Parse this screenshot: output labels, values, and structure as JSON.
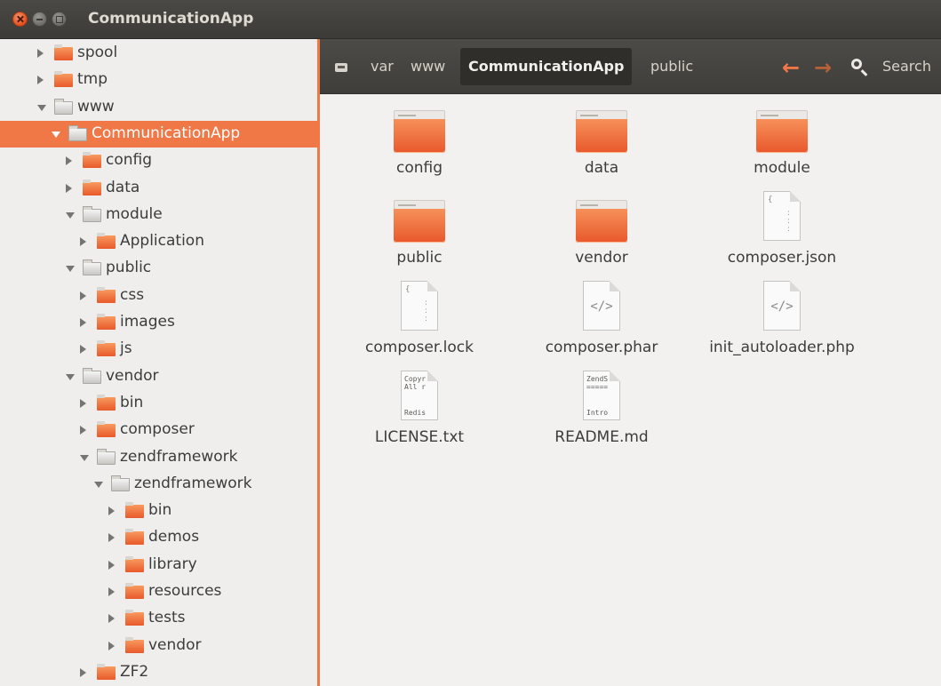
{
  "window": {
    "title": "CommunicationApp"
  },
  "sidebar": {
    "items": [
      {
        "label": "spool",
        "depth": 0,
        "state": "collapsed",
        "folder": "orange"
      },
      {
        "label": "tmp",
        "depth": 0,
        "state": "collapsed",
        "folder": "orange"
      },
      {
        "label": "www",
        "depth": 0,
        "state": "expanded",
        "folder": "gray"
      },
      {
        "label": "CommunicationApp",
        "depth": 1,
        "state": "expanded",
        "folder": "gray",
        "selected": true
      },
      {
        "label": "config",
        "depth": 2,
        "state": "collapsed",
        "folder": "orange"
      },
      {
        "label": "data",
        "depth": 2,
        "state": "collapsed",
        "folder": "orange"
      },
      {
        "label": "module",
        "depth": 2,
        "state": "expanded",
        "folder": "gray"
      },
      {
        "label": "Application",
        "depth": 3,
        "state": "collapsed",
        "folder": "orange"
      },
      {
        "label": "public",
        "depth": 2,
        "state": "expanded",
        "folder": "gray"
      },
      {
        "label": "css",
        "depth": 3,
        "state": "collapsed",
        "folder": "orange"
      },
      {
        "label": "images",
        "depth": 3,
        "state": "collapsed",
        "folder": "orange"
      },
      {
        "label": "js",
        "depth": 3,
        "state": "collapsed",
        "folder": "orange"
      },
      {
        "label": "vendor",
        "depth": 2,
        "state": "expanded",
        "folder": "gray"
      },
      {
        "label": "bin",
        "depth": 3,
        "state": "collapsed",
        "folder": "orange"
      },
      {
        "label": "composer",
        "depth": 3,
        "state": "collapsed",
        "folder": "orange"
      },
      {
        "label": "zendframework",
        "depth": 3,
        "state": "expanded",
        "folder": "gray"
      },
      {
        "label": "zendframework",
        "depth": 4,
        "state": "expanded",
        "folder": "gray"
      },
      {
        "label": "bin",
        "depth": 5,
        "state": "collapsed",
        "folder": "orange"
      },
      {
        "label": "demos",
        "depth": 5,
        "state": "collapsed",
        "folder": "orange"
      },
      {
        "label": "library",
        "depth": 5,
        "state": "collapsed",
        "folder": "orange"
      },
      {
        "label": "resources",
        "depth": 5,
        "state": "collapsed",
        "folder": "orange"
      },
      {
        "label": "tests",
        "depth": 5,
        "state": "collapsed",
        "folder": "orange"
      },
      {
        "label": "vendor",
        "depth": 5,
        "state": "collapsed",
        "folder": "orange"
      },
      {
        "label": "ZF2",
        "depth": 3,
        "state": "collapsed",
        "folder": "orange"
      }
    ]
  },
  "toolbar": {
    "breadcrumbs": [
      "var",
      "www",
      "CommunicationApp",
      "public"
    ],
    "active_crumb": "CommunicationApp",
    "back_icon": "arrow-left-icon",
    "forward_icon": "arrow-right-icon",
    "search_label": "Search"
  },
  "files": [
    {
      "name": "config",
      "kind": "folder"
    },
    {
      "name": "data",
      "kind": "folder"
    },
    {
      "name": "module",
      "kind": "folder"
    },
    {
      "name": "public",
      "kind": "folder"
    },
    {
      "name": "vendor",
      "kind": "folder"
    },
    {
      "name": "composer.json",
      "kind": "json"
    },
    {
      "name": "composer.lock",
      "kind": "json"
    },
    {
      "name": "composer.phar",
      "kind": "code"
    },
    {
      "name": "init_autoloader.php",
      "kind": "code"
    },
    {
      "name": "LICENSE.txt",
      "kind": "text",
      "preview_top": "Copyr\nAll r",
      "preview_bottom": "Redis"
    },
    {
      "name": "README.md",
      "kind": "text",
      "preview_top": "ZendS\n=====",
      "preview_bottom": "Intro"
    }
  ],
  "colors": {
    "accent": "#f07746",
    "titlebar": "#3c3b37",
    "background": "#f2f1f0"
  }
}
